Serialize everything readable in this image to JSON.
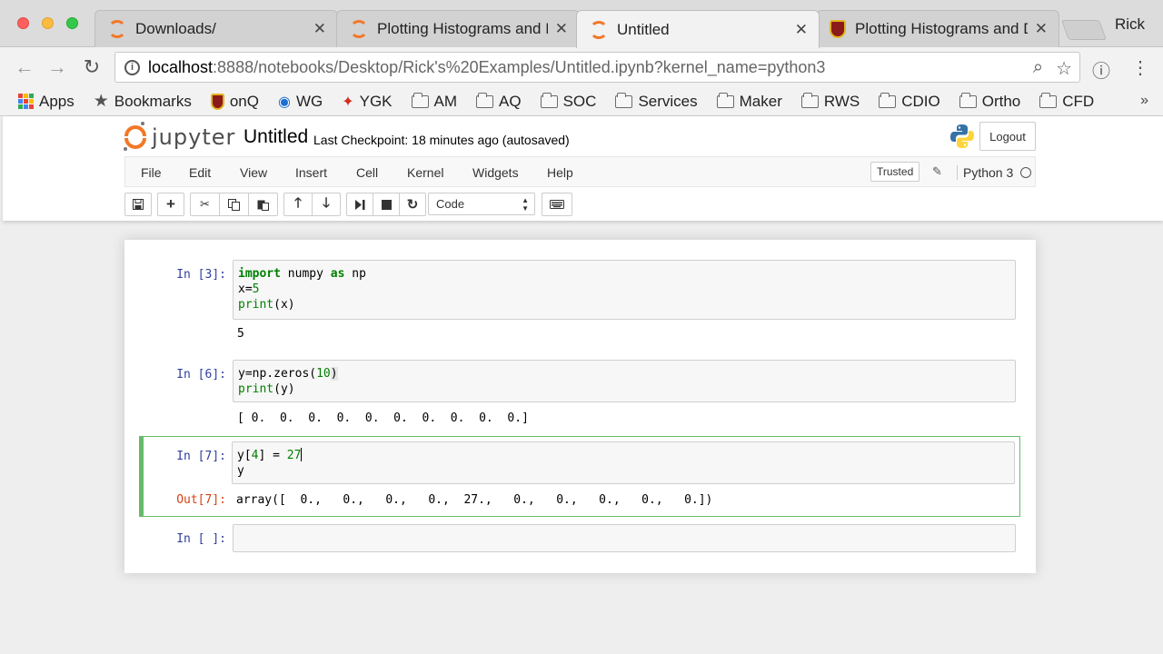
{
  "browser": {
    "tabs": [
      {
        "title": "Downloads/",
        "icon": "jupyter-icon",
        "active": false
      },
      {
        "title": "Plotting Histograms and D",
        "icon": "jupyter-icon",
        "active": false
      },
      {
        "title": "Untitled",
        "icon": "jupyter-icon",
        "active": true
      },
      {
        "title": "Plotting Histograms and D",
        "icon": "shield-icon",
        "active": false
      }
    ],
    "profile_name": "Rick",
    "url_host": "localhost",
    "url_rest": ":8888/notebooks/Desktop/Rick's%20Examples/Untitled.ipynb?kernel_name=python3",
    "bookmarks": [
      {
        "label": "Apps",
        "icon": "apps-grid-icon"
      },
      {
        "label": "Bookmarks",
        "icon": "star-icon"
      },
      {
        "label": "onQ",
        "icon": "shield-icon"
      },
      {
        "label": "WG",
        "icon": "globe-icon"
      },
      {
        "label": "YGK",
        "icon": "maple-leaf-icon"
      },
      {
        "label": "AM",
        "icon": "folder-icon"
      },
      {
        "label": "AQ",
        "icon": "folder-icon"
      },
      {
        "label": "SOC",
        "icon": "folder-icon"
      },
      {
        "label": "Services",
        "icon": "folder-icon"
      },
      {
        "label": "Maker",
        "icon": "folder-icon"
      },
      {
        "label": "RWS",
        "icon": "folder-icon"
      },
      {
        "label": "CDIO",
        "icon": "folder-icon"
      },
      {
        "label": "Ortho",
        "icon": "folder-icon"
      },
      {
        "label": "CFD",
        "icon": "folder-icon"
      }
    ],
    "more_bookmarks": "»"
  },
  "jupyter": {
    "logo_text": "jupyter",
    "notebook_name": "Untitled",
    "checkpoint": "Last Checkpoint: 18 minutes ago (autosaved)",
    "logout_label": "Logout",
    "menu": [
      "File",
      "Edit",
      "View",
      "Insert",
      "Cell",
      "Kernel",
      "Widgets",
      "Help"
    ],
    "trusted_label": "Trusted",
    "kernel_name": "Python 3",
    "cell_type": "Code"
  },
  "cells": [
    {
      "prompt": "In [3]:",
      "lines": [
        [
          {
            "t": "import",
            "c": "kw"
          },
          {
            "t": " numpy ",
            "c": ""
          },
          {
            "t": "as",
            "c": "kw"
          },
          {
            "t": " np",
            "c": ""
          }
        ],
        [
          {
            "t": "x=",
            "c": ""
          },
          {
            "t": "5",
            "c": "num"
          }
        ],
        [
          {
            "t": "print",
            "c": "bi"
          },
          {
            "t": "(x)",
            "c": ""
          }
        ]
      ],
      "output": "5"
    },
    {
      "prompt": "In [6]:",
      "lines": [
        [
          {
            "t": "y=np.zeros(",
            "c": ""
          },
          {
            "t": "10",
            "c": "num"
          },
          {
            "t": ")",
            "c": "hl"
          }
        ],
        [
          {
            "t": "print",
            "c": "bi"
          },
          {
            "t": "(y)",
            "c": ""
          }
        ]
      ],
      "output": "[ 0.  0.  0.  0.  0.  0.  0.  0.  0.  0.]"
    },
    {
      "prompt": "In [7]:",
      "lines": [
        [
          {
            "t": "y[",
            "c": ""
          },
          {
            "t": "4",
            "c": "num"
          },
          {
            "t": "] = ",
            "c": ""
          },
          {
            "t": "27",
            "c": "num"
          },
          {
            "t": "",
            "c": "cursor"
          }
        ],
        [
          {
            "t": "y",
            "c": ""
          }
        ]
      ],
      "out_prompt": "Out[7]:",
      "output": "array([  0.,   0.,   0.,   0.,  27.,   0.,   0.,   0.,   0.,   0.])"
    },
    {
      "prompt": "In [ ]:",
      "lines": [
        []
      ],
      "output": ""
    }
  ]
}
